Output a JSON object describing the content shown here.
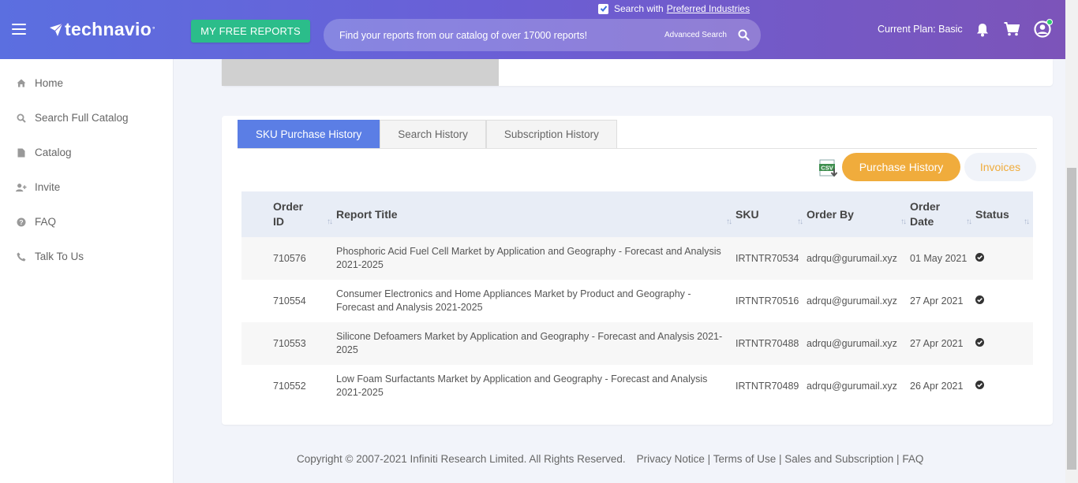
{
  "header": {
    "logo_text": "technavio",
    "logo_tm": "°",
    "free_reports_label": "MY FREE REPORTS",
    "search_placeholder": "Find your reports from our catalog of over 17000 reports!",
    "advanced_search_label": "Advanced Search",
    "preferred_prefix": "Search with",
    "preferred_link": "Preferred Industries",
    "preferred_checked": true,
    "plan_text": "Current Plan: Basic",
    "brand_gradient": [
      "#5b6fe0",
      "#7c54b9"
    ]
  },
  "sidebar": {
    "items": [
      {
        "label": "Home",
        "icon": "home-icon"
      },
      {
        "label": "Search Full Catalog",
        "icon": "search-icon"
      },
      {
        "label": "Catalog",
        "icon": "file-icon"
      },
      {
        "label": "Invite",
        "icon": "user-plus-icon"
      },
      {
        "label": "FAQ",
        "icon": "question-icon"
      },
      {
        "label": "Talk To Us",
        "icon": "phone-icon"
      }
    ]
  },
  "tabs": [
    {
      "label": "SKU Purchase History",
      "active": true
    },
    {
      "label": "Search History",
      "active": false
    },
    {
      "label": "Subscription History",
      "active": false
    }
  ],
  "actions": {
    "csv_icon": "csv-download-icon",
    "purchase_history_label": "Purchase History",
    "invoices_label": "Invoices"
  },
  "table": {
    "headers": [
      "Order ID",
      "Report Title",
      "SKU",
      "Order By",
      "Order Date",
      "Status"
    ],
    "rows": [
      {
        "order_id": "710576",
        "title": "Phosphoric Acid Fuel Cell Market by Application and Geography - Forecast and Analysis 2021-2025",
        "sku": "IRTNTR70534",
        "order_by": "adrqu@gurumail.xyz",
        "date": "01 May 2021",
        "status_icon": "check-circle-icon"
      },
      {
        "order_id": "710554",
        "title": "Consumer Electronics and Home Appliances Market by Product and Geography - Forecast and Analysis 2021-2025",
        "sku": "IRTNTR70516",
        "order_by": "adrqu@gurumail.xyz",
        "date": "27 Apr 2021",
        "status_icon": "check-circle-icon"
      },
      {
        "order_id": "710553",
        "title": "Silicone Defoamers Market by Application and Geography - Forecast and Analysis 2021-2025",
        "sku": "IRTNTR70488",
        "order_by": "adrqu@gurumail.xyz",
        "date": "27 Apr 2021",
        "status_icon": "check-circle-icon"
      },
      {
        "order_id": "710552",
        "title": "Low Foam Surfactants Market by Application and Geography - Forecast and Analysis 2021-2025",
        "sku": "IRTNTR70489",
        "order_by": "adrqu@gurumail.xyz",
        "date": "26 Apr 2021",
        "status_icon": "check-circle-icon"
      }
    ]
  },
  "footer": {
    "copyright": "Copyright © 2007-2021 Infiniti Research Limited. All Rights Reserved.",
    "links": "Privacy Notice | Terms of Use | Sales and Subscription | FAQ"
  }
}
